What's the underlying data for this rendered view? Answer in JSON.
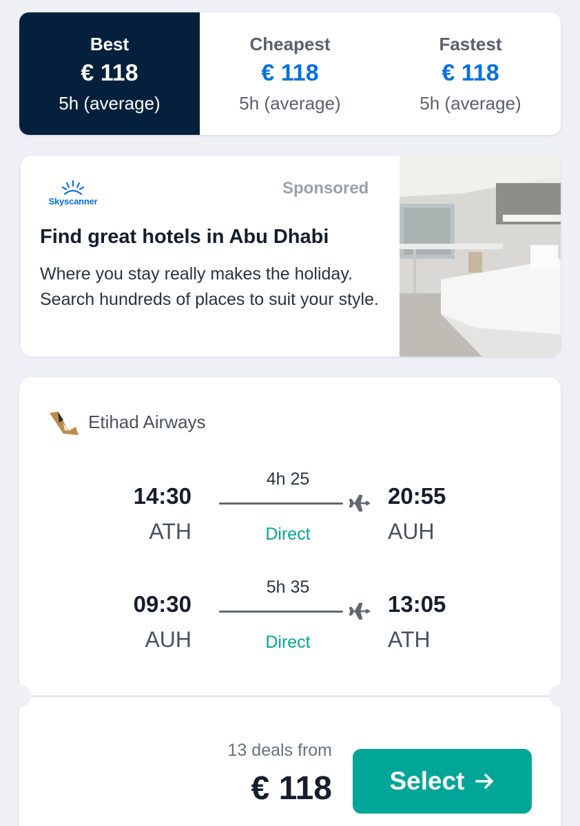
{
  "sort_tabs": [
    {
      "title": "Best",
      "price": "€ 118",
      "duration": "5h (average)",
      "active": true
    },
    {
      "title": "Cheapest",
      "price": "€ 118",
      "duration": "5h (average)",
      "active": false
    },
    {
      "title": "Fastest",
      "price": "€ 118",
      "duration": "5h (average)",
      "active": false
    }
  ],
  "ad": {
    "brand": "Skyscanner",
    "sponsored_label": "Sponsored",
    "title": "Find great hotels in Abu Dhabi",
    "body": "Where you stay really makes the holiday. Search hundreds of places to suit your style.",
    "image_icon": "hotel-room-image"
  },
  "flight": {
    "airline": "Etihad Airways",
    "airline_icon": "etihad-logo-icon",
    "legs": [
      {
        "dep_time": "14:30",
        "dep_code": "ATH",
        "duration": "4h 25",
        "stops": "Direct",
        "arr_time": "20:55",
        "arr_code": "AUH"
      },
      {
        "dep_time": "09:30",
        "dep_code": "AUH",
        "duration": "5h 35",
        "stops": "Direct",
        "arr_time": "13:05",
        "arr_code": "ATH"
      }
    ],
    "deals_label": "13 deals from",
    "price": "€ 118",
    "select_label": "Select"
  },
  "colors": {
    "active_tab_bg": "#05203c",
    "price_blue": "#0770e3",
    "accent_teal": "#00a698",
    "page_bg": "#eef0f6"
  }
}
